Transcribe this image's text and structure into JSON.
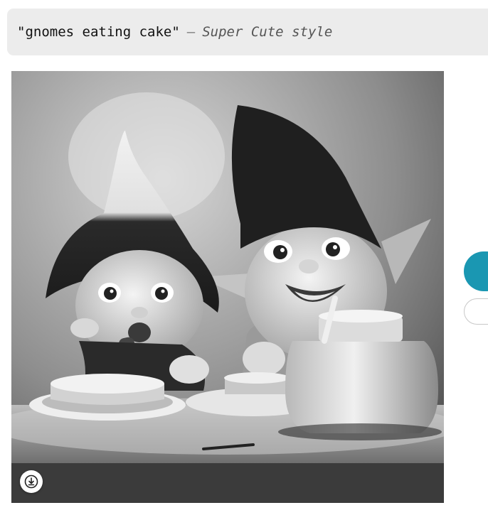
{
  "prompt": {
    "text": "\"gnomes eating cake\"",
    "separator": "—",
    "style": "Super Cute style"
  },
  "image": {
    "alt": "gnomes eating cake, super cute style"
  },
  "actions": {
    "download_icon": "download-icon"
  },
  "colors": {
    "accent": "#1a97b2",
    "prompt_background": "#ececec"
  }
}
